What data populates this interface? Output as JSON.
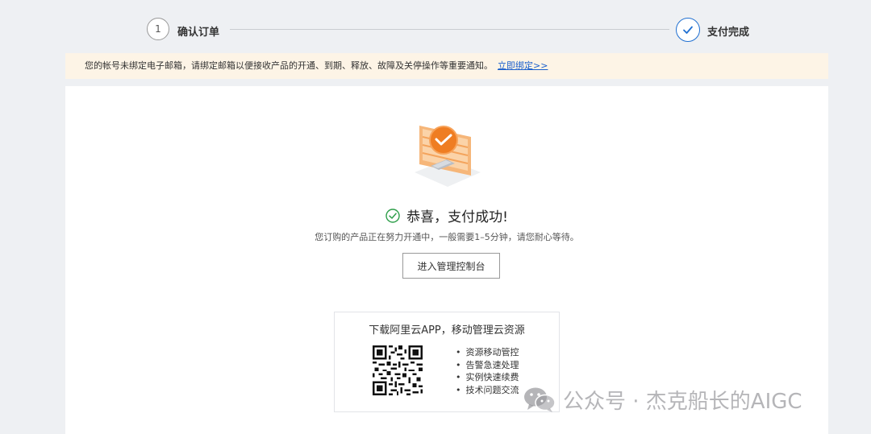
{
  "steps": {
    "step1_number": "1",
    "step1_label": "确认订单",
    "step2_label": "支付完成"
  },
  "notice": {
    "text": "您的帐号未绑定电子邮箱，请绑定邮箱以便接收产品的开通、到期、释放、故障及关停操作等重要通知。",
    "link": "立即绑定>>"
  },
  "result": {
    "title": "恭喜，支付成功!",
    "subtitle": "您订购的产品正在努力开通中，一般需要1–5分钟，请您耐心等待。",
    "console_button": "进入管理控制台"
  },
  "app_promo": {
    "title": "下载阿里云APP，移动管理云资源",
    "features": [
      "资源移动管控",
      "告警急速处理",
      "实例快速续费",
      "技术问题交流"
    ]
  },
  "watermark": {
    "text": "公众号 · 杰克船长的AIGC"
  },
  "colors": {
    "accent": "#1f6fd1",
    "success": "#2e9e4a",
    "notice_bg": "#fdf4e6",
    "illustration": "#f08a2c"
  }
}
